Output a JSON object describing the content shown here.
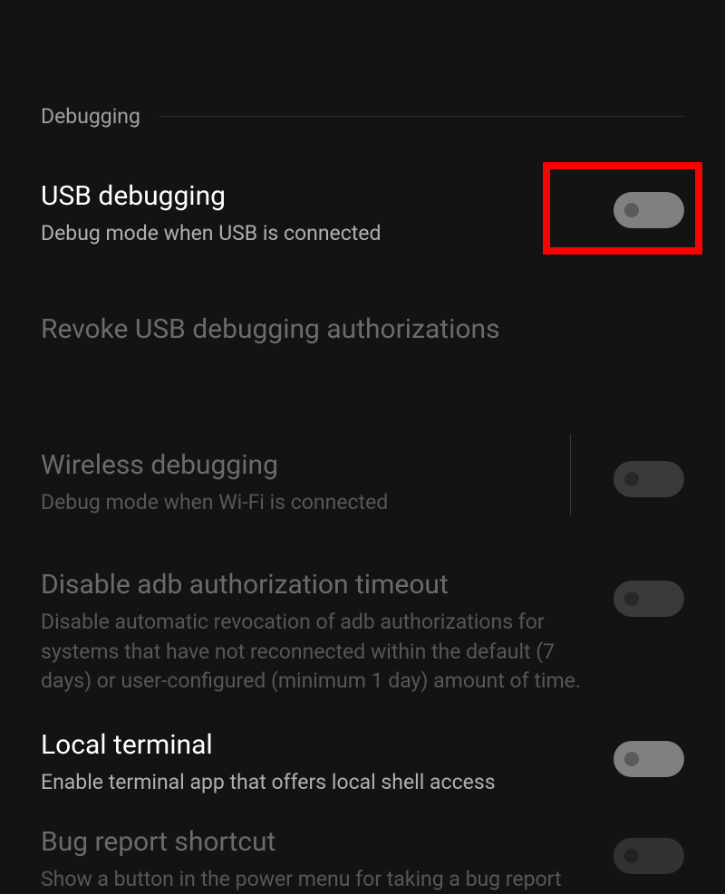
{
  "section": {
    "title": "Debugging"
  },
  "settings": {
    "usb": {
      "title": "USB debugging",
      "subtitle": "Debug mode when USB is connected"
    },
    "revoke": {
      "title": "Revoke USB debugging authorizations"
    },
    "wireless": {
      "title": "Wireless debugging",
      "subtitle": "Debug mode when Wi-Fi is connected"
    },
    "adb": {
      "title": "Disable adb authorization timeout",
      "subtitle": "Disable automatic revocation of adb authorizations for systems that have not reconnected within the default (7 days) or user-configured (minimum 1 day) amount of time."
    },
    "local": {
      "title": "Local terminal",
      "subtitle": "Enable terminal app that offers local shell access"
    },
    "bug": {
      "title": "Bug report shortcut",
      "subtitle": "Show a button in the power menu for taking a bug report"
    }
  }
}
